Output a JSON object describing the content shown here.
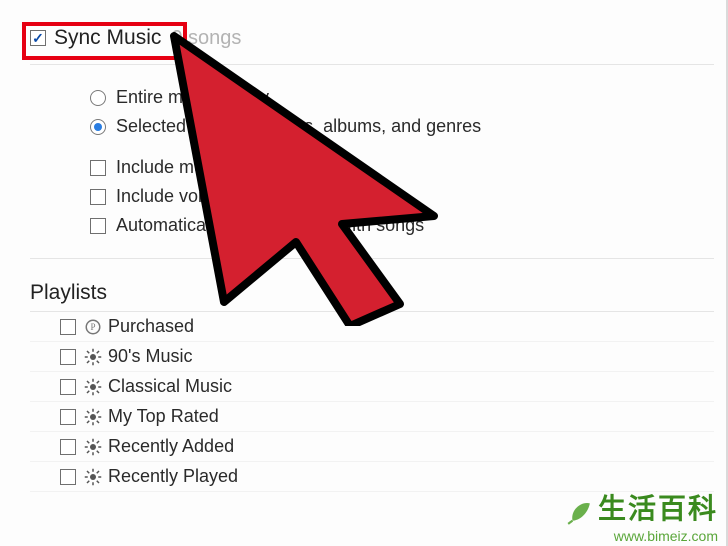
{
  "header": {
    "checkbox_checked": true,
    "title": "Sync Music",
    "subtitle": "0 songs"
  },
  "options": {
    "radio": [
      {
        "label": "Entire music library",
        "selected": false
      },
      {
        "label": "Selected playlists, artists, albums, and genres",
        "selected": true
      }
    ],
    "checks": [
      {
        "label": "Include music videos",
        "checked": false
      },
      {
        "label": "Include voice memos",
        "checked": false
      },
      {
        "label": "Automatically fill free space with songs",
        "checked": false
      }
    ]
  },
  "playlists": {
    "title": "Playlists",
    "items": [
      {
        "label": "Purchased",
        "icon": "purchased"
      },
      {
        "label": "90's Music",
        "icon": "smart"
      },
      {
        "label": "Classical Music",
        "icon": "smart"
      },
      {
        "label": "My Top Rated",
        "icon": "smart"
      },
      {
        "label": "Recently Added",
        "icon": "smart"
      },
      {
        "label": "Recently Played",
        "icon": "smart"
      }
    ]
  },
  "annotation": {
    "highlight_target": "sync-music-checkbox",
    "cursor_icon": "arrow-cursor"
  },
  "watermark": {
    "line1": "生活百科",
    "line2": "www.bimeiz.com"
  }
}
